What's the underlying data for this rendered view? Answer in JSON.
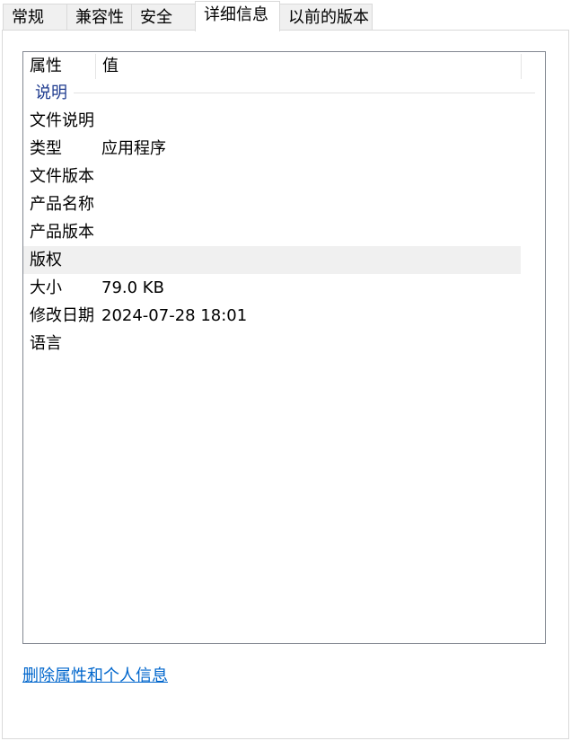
{
  "tabs": [
    {
      "label": "常规",
      "active": false
    },
    {
      "label": "兼容性",
      "active": false
    },
    {
      "label": "安全",
      "active": false
    },
    {
      "label": "详细信息",
      "active": true
    },
    {
      "label": "以前的版本",
      "active": false
    }
  ],
  "list": {
    "columns": {
      "name": "属性",
      "value": "值"
    },
    "group": "说明",
    "rows": [
      {
        "name": "文件说明",
        "value": ""
      },
      {
        "name": "类型",
        "value": "应用程序"
      },
      {
        "name": "文件版本",
        "value": ""
      },
      {
        "name": "产品名称",
        "value": ""
      },
      {
        "name": "产品版本",
        "value": ""
      },
      {
        "name": "版权",
        "value": ""
      },
      {
        "name": "大小",
        "value": "79.0 KB"
      },
      {
        "name": "修改日期",
        "value": "2024-07-28 18:01"
      },
      {
        "name": "语言",
        "value": ""
      }
    ]
  },
  "remove_link": "删除属性和个人信息"
}
